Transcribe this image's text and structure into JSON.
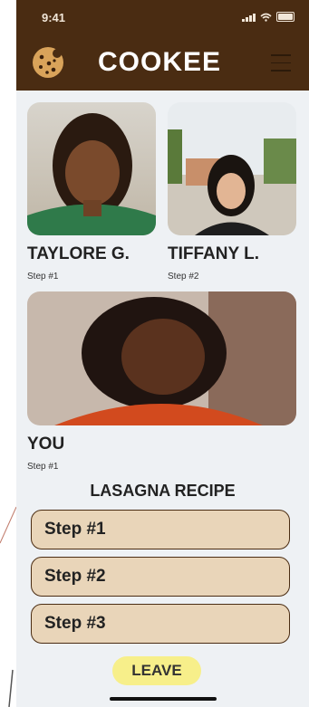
{
  "status_bar": {
    "time": "9:41"
  },
  "header": {
    "title": "COOKEE"
  },
  "participants": [
    {
      "name": "TAYLORE G.",
      "step": "Step #1"
    },
    {
      "name": "TIFFANY L.",
      "step": "Step #2"
    },
    {
      "name": "YOU",
      "step": "Step #1"
    }
  ],
  "recipe": {
    "title": "LASAGNA RECIPE",
    "steps": [
      "Step #1",
      "Step #2",
      "Step #3"
    ]
  },
  "actions": {
    "leave_label": "LEAVE"
  },
  "colors": {
    "header_bg": "#4a2c12",
    "step_bg": "#e9d5b9",
    "leave_bg": "#f7ef8a"
  },
  "icons": [
    "cookie-logo-icon",
    "hamburger-menu-icon",
    "camera-switch-icon",
    "signal-icon",
    "wifi-icon",
    "battery-icon"
  ]
}
